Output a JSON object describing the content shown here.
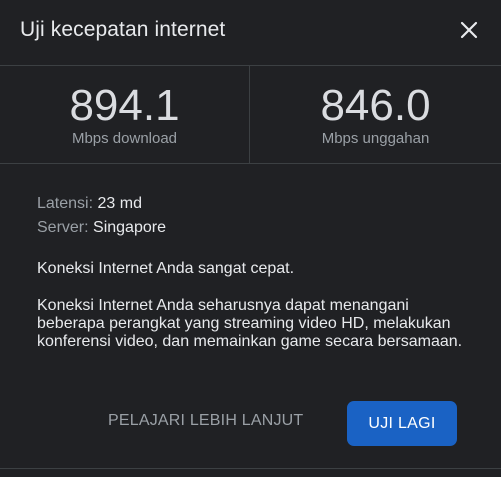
{
  "dialog": {
    "title": "Uji kecepatan internet",
    "close_icon": "close-icon"
  },
  "speeds": {
    "download": {
      "value": "894.1",
      "unit": "Mbps download"
    },
    "upload": {
      "value": "846.0",
      "unit": "Mbps unggahan"
    }
  },
  "details": {
    "latency_label": "Latensi:",
    "latency_value": "23 md",
    "server_label": "Server:",
    "server_value": "Singapore"
  },
  "messages": {
    "summary": "Koneksi Internet Anda sangat cepat.",
    "description": "Koneksi Internet Anda seharusnya dapat menangani beberapa perangkat yang streaming video HD, melakukan konferensi video, dan memainkan game secara bersamaan."
  },
  "actions": {
    "learn_more": "PELAJARI LEBIH LANJUT",
    "retry": "UJI LAGI"
  },
  "colors": {
    "background": "#202124",
    "primary_button": "#1a62c4",
    "divider": "#3c4043"
  }
}
